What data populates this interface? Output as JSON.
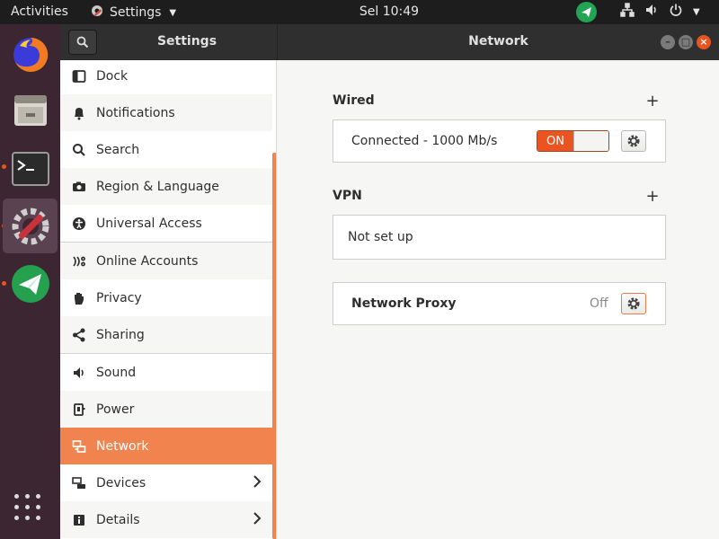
{
  "topbar": {
    "activities": "Activities",
    "app_menu": "Settings",
    "clock": "Sel 10:49",
    "tray_icons": [
      "telegram-icon",
      "network-icon",
      "volume-icon",
      "power-icon"
    ]
  },
  "dock": {
    "items": [
      {
        "name": "firefox",
        "running": false
      },
      {
        "name": "files",
        "running": false
      },
      {
        "name": "terminal",
        "running": true
      },
      {
        "name": "settings",
        "running": true,
        "active": true
      },
      {
        "name": "telegram",
        "running": true
      }
    ],
    "show_apps_icon": "grid-icon"
  },
  "window": {
    "sidebar_title": "Settings",
    "panel_title": "Network"
  },
  "sidebar": {
    "items": [
      {
        "label": "Dock",
        "icon": "dock-icon"
      },
      {
        "label": "Notifications",
        "icon": "bell-icon"
      },
      {
        "label": "Search",
        "icon": "search-icon"
      },
      {
        "label": "Region & Language",
        "icon": "camera-icon"
      },
      {
        "label": "Universal Access",
        "icon": "accessibility-icon"
      },
      {
        "label": "Online Accounts",
        "icon": "online-accounts-icon"
      },
      {
        "label": "Privacy",
        "icon": "hand-icon"
      },
      {
        "label": "Sharing",
        "icon": "share-icon"
      },
      {
        "label": "Sound",
        "icon": "speaker-icon"
      },
      {
        "label": "Power",
        "icon": "power-plug-icon"
      },
      {
        "label": "Network",
        "icon": "network-icon",
        "selected": true
      },
      {
        "label": "Devices",
        "icon": "devices-icon",
        "has_submenu": true
      },
      {
        "label": "Details",
        "icon": "info-icon",
        "has_submenu": true
      }
    ]
  },
  "network": {
    "wired": {
      "title": "Wired",
      "status": "Connected - 1000 Mb/s",
      "switch_label": "ON"
    },
    "vpn": {
      "title": "VPN",
      "status": "Not set up"
    },
    "proxy": {
      "label": "Network Proxy",
      "value": "Off"
    }
  },
  "colors": {
    "accent": "#e95420",
    "selection": "#f0834e",
    "topbar": "#1d1d1d",
    "dock": "#3b2632"
  }
}
